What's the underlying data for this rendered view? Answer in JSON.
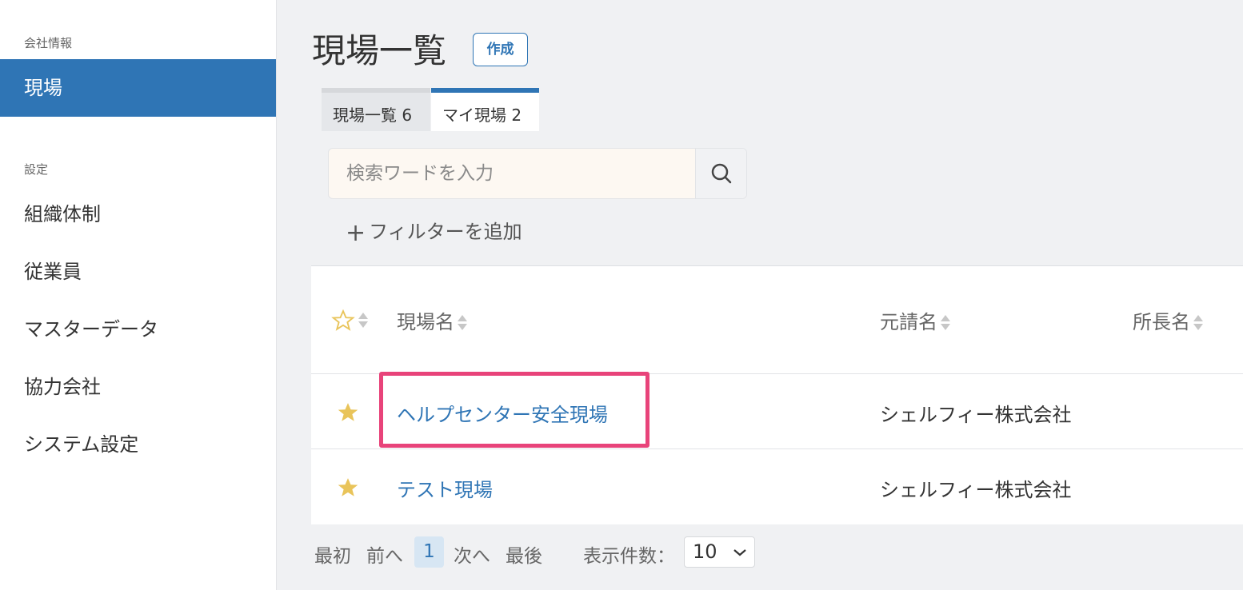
{
  "sidebar": {
    "section_company": "会社情報",
    "item_sites": "現場",
    "section_settings": "設定",
    "items": [
      "組織体制",
      "従業員",
      "マスターデータ",
      "協力会社",
      "システム設定"
    ]
  },
  "header": {
    "title": "現場一覧",
    "create_label": "作成"
  },
  "tabs": [
    {
      "label": "現場一覧 6"
    },
    {
      "label": "マイ現場 2"
    }
  ],
  "search": {
    "placeholder": "検索ワードを入力",
    "value": ""
  },
  "filter": {
    "add_label": "フィルターを追加"
  },
  "table": {
    "columns": [
      "現場名",
      "元請名",
      "所長名"
    ],
    "rows": [
      {
        "starred": true,
        "name": "ヘルプセンター安全現場",
        "contractor": "シェルフィー株式会社",
        "manager": ""
      },
      {
        "starred": true,
        "name": "テスト現場",
        "contractor": "シェルフィー株式会社",
        "manager": ""
      }
    ]
  },
  "pagination": {
    "first": "最初",
    "prev": "前へ",
    "current": "1",
    "next": "次へ",
    "last": "最後",
    "per_page_label": "表示件数：",
    "per_page_value": "10"
  },
  "colors": {
    "accent": "#2f75b5",
    "highlight": "#e8437a",
    "star": "#e9c45a"
  }
}
